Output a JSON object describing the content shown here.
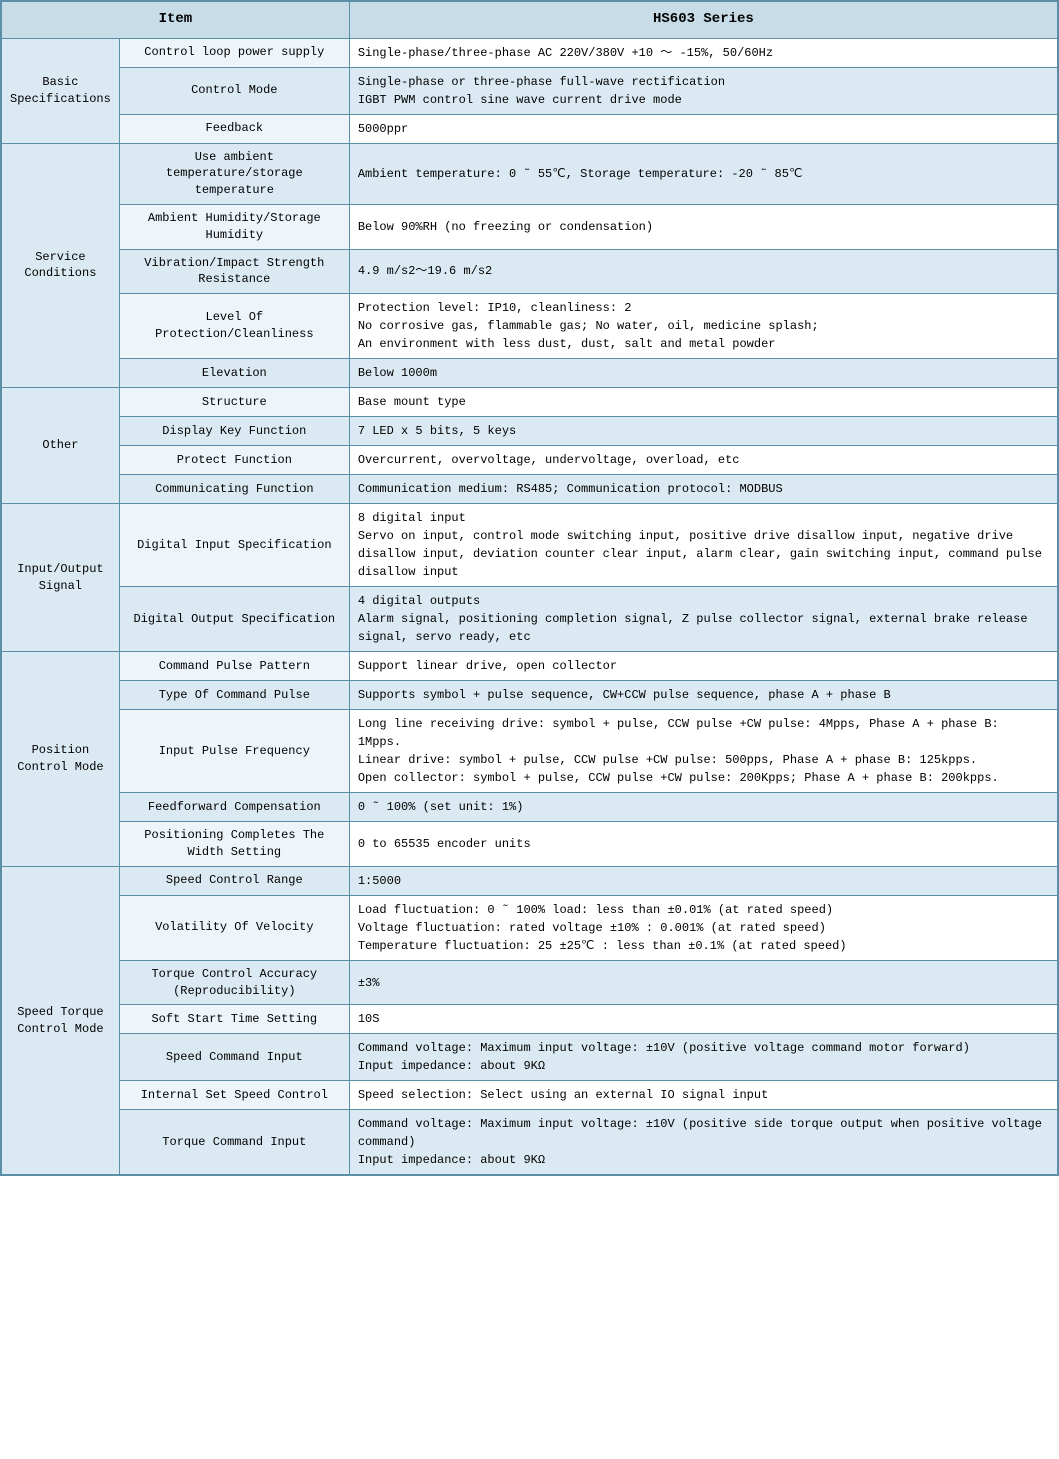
{
  "header": {
    "col1": "Item",
    "col2": "HS603 Series"
  },
  "sections": [
    {
      "category": "Basic Specifications",
      "rows": [
        {
          "sub": "Control loop power supply",
          "val": "Single-phase/three-phase AC 220V/380V +10 ～ -15%, 50/60Hz",
          "shaded": false
        },
        {
          "sub": "Control Mode",
          "val": "Single-phase or three-phase full-wave rectification\nIGBT PWM control sine wave current drive mode",
          "shaded": true
        },
        {
          "sub": "Feedback",
          "val": "5000ppr",
          "shaded": false
        }
      ]
    },
    {
      "category": "Service Conditions",
      "rows": [
        {
          "sub": "Use ambient temperature/storage temperature",
          "val": "Ambient temperature: 0 ˜ 55℃, Storage temperature: -20 ˜ 85℃",
          "shaded": true
        },
        {
          "sub": "Ambient Humidity/Storage Humidity",
          "val": "Below 90%RH (no freezing or condensation)",
          "shaded": false
        },
        {
          "sub": "Vibration/Impact Strength Resistance",
          "val": "4.9 m/s2～19.6 m/s2",
          "shaded": true
        },
        {
          "sub": "Level Of Protection/Cleanliness",
          "val": "Protection level: IP10, cleanliness: 2\nNo corrosive gas, flammable gas; No water, oil, medicine splash;\nAn environment with less dust, dust, salt and metal powder",
          "shaded": false
        },
        {
          "sub": "Elevation",
          "val": "Below 1000m",
          "shaded": true
        }
      ]
    },
    {
      "category": "Other",
      "rows": [
        {
          "sub": "Structure",
          "val": "Base mount type",
          "shaded": false
        },
        {
          "sub": "Display Key Function",
          "val": "7 LED x 5 bits, 5 keys",
          "shaded": true
        },
        {
          "sub": "Protect Function",
          "val": "Overcurrent, overvoltage, undervoltage, overload, etc",
          "shaded": false
        },
        {
          "sub": "Communicating Function",
          "val": "Communication medium: RS485; Communication protocol: MODBUS",
          "shaded": true
        }
      ]
    },
    {
      "category": "Input/Output Signal",
      "rows": [
        {
          "sub": "Digital Input Specification",
          "val": "8 digital input\nServo on input, control mode switching input, positive drive disallow input, negative drive disallow input, deviation counter clear input, alarm clear, gain switching input, command pulse disallow input",
          "shaded": false
        },
        {
          "sub": "Digital Output Specification",
          "val": "4 digital outputs\nAlarm signal, positioning completion signal, Z pulse collector signal, external brake release signal, servo ready, etc",
          "shaded": true
        }
      ]
    },
    {
      "category": "Position Control Mode",
      "rows": [
        {
          "sub": "Command Pulse Pattern",
          "val": "Support linear drive, open collector",
          "shaded": false
        },
        {
          "sub": "Type Of Command Pulse",
          "val": "Supports symbol + pulse sequence, CW+CCW pulse sequence, phase A + phase B",
          "shaded": true
        },
        {
          "sub": "Input Pulse Frequency",
          "val": "Long line receiving drive: symbol + pulse, CCW pulse +CW pulse: 4Mpps, Phase A + phase B: 1Mpps.\nLinear drive: symbol + pulse, CCW pulse +CW pulse: 500pps, Phase A + phase B: 125kpps.\nOpen collector: symbol + pulse, CCW pulse +CW pulse: 200Kpps; Phase A + phase B: 200kpps.",
          "shaded": false
        },
        {
          "sub": "Feedforward Compensation",
          "val": "0 ˜ 100% (set unit: 1%)",
          "shaded": true
        },
        {
          "sub": "Positioning Completes The Width Setting",
          "val": "0 to 65535 encoder units",
          "shaded": false
        }
      ]
    },
    {
      "category": "Speed Torque Control Mode",
      "rows": [
        {
          "sub": "Speed Control Range",
          "val": "1:5000",
          "shaded": true
        },
        {
          "sub": "Volatility Of Velocity",
          "val": "Load fluctuation: 0 ˜ 100% load: less than ±0.01% (at rated speed)\nVoltage fluctuation: rated voltage ±10% : 0.001% (at rated speed)\nTemperature fluctuation: 25 ±25℃ : less than ±0.1% (at rated speed)",
          "shaded": false
        },
        {
          "sub": "Torque Control Accuracy (Reproducibility)",
          "val": "±3%",
          "shaded": true
        },
        {
          "sub": "Soft Start Time Setting",
          "val": "10S",
          "shaded": false
        },
        {
          "sub": "Speed Command Input",
          "val": "Command voltage: Maximum input voltage: ±10V (positive voltage command motor forward)\nInput impedance: about 9KΩ",
          "shaded": true
        },
        {
          "sub": "Internal Set Speed Control",
          "val": "Speed selection: Select using an external IO signal input",
          "shaded": false
        },
        {
          "sub": "Torque Command Input",
          "val": "Command voltage: Maximum input voltage: ±10V (positive side torque output when positive voltage command)\nInput impedance: about 9KΩ",
          "shaded": true
        }
      ]
    }
  ]
}
